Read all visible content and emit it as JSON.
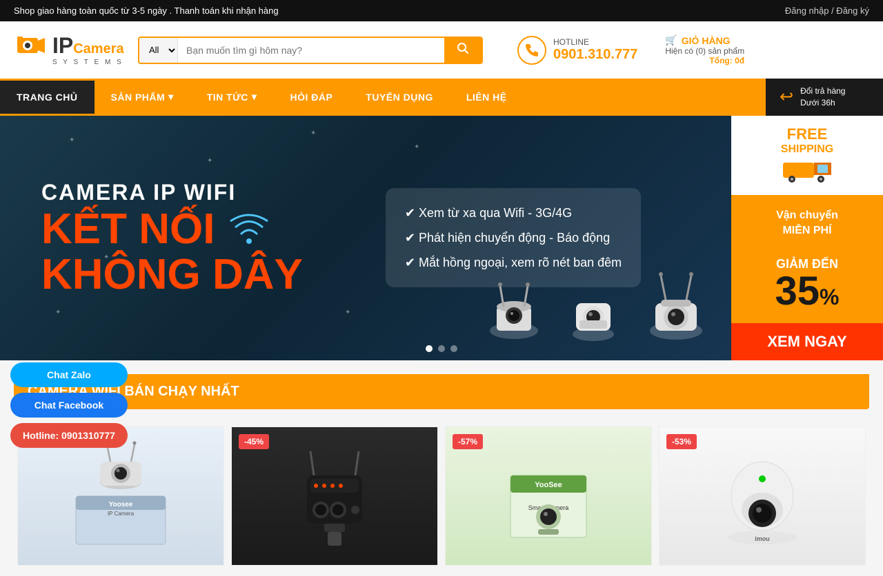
{
  "topbar": {
    "message": "Shop giao hàng toàn quốc từ 3-5 ngày  .  Thanh toán khi nhận hàng",
    "login": "Đăng nhập / Đăng ký"
  },
  "header": {
    "logo": {
      "ip": "IP",
      "camera": "Camera",
      "systems": "S Y S T E M S"
    },
    "search": {
      "select_default": "All",
      "placeholder": "Bạn muốn tìm gì hôm nay?"
    },
    "hotline": {
      "label": "HOTLINE",
      "number": "0901.310.777"
    },
    "cart": {
      "title": "GIỎ HÀNG",
      "info": "Hiện có (0) sản phẩm",
      "total": "Tổng: 0đ"
    }
  },
  "nav": {
    "items": [
      {
        "label": "TRANG CHỦ",
        "active": true
      },
      {
        "label": "SẢN PHẨM",
        "dropdown": true
      },
      {
        "label": "TIN TỨC",
        "dropdown": true
      },
      {
        "label": "HỎI ĐÁP"
      },
      {
        "label": "TUYỂN DỤNG"
      },
      {
        "label": "LIÊN HỆ"
      }
    ],
    "return": {
      "label1": "Đổi trả hàng",
      "label2": "Dưới 36h"
    }
  },
  "banner": {
    "line1": "CAMERA IP WIFI",
    "line2": "KẾT NỐI",
    "line3": "KHÔNG DÂY",
    "features": [
      "Xem từ xa qua Wifi - 3G/4G",
      "Phát hiện chuyển động - Báo động",
      "Mắt hồng ngoại, xem rõ nét ban đêm"
    ],
    "free_shipping": "FREE SHIPPING",
    "van_chuyen": "Vận chuyển\nMIỄN PHÍ",
    "giam_den": "GIẢM ĐẾN",
    "percent": "35",
    "pct_sign": "%",
    "xem_ngay": "XEM NGAY"
  },
  "section": {
    "title": "CAMERA WIFI BÁN CHẠY NHẤT"
  },
  "products": [
    {
      "discount": "",
      "bg": "prod-bg-1"
    },
    {
      "discount": "-45%",
      "bg": "prod-bg-2"
    },
    {
      "discount": "-57%",
      "bg": "prod-bg-3"
    },
    {
      "discount": "-53%",
      "bg": "prod-bg-4"
    }
  ],
  "floating": {
    "zalo": "Chat Zalo",
    "facebook": "Chat Facebook",
    "hotline": "Hotline: 0901310777"
  }
}
